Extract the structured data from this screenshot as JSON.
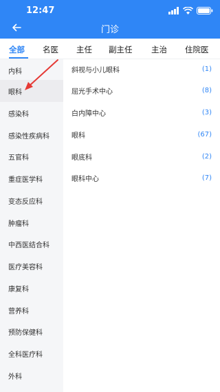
{
  "status": {
    "time": "12:47"
  },
  "header": {
    "title": "门诊"
  },
  "tabs": [
    "全部",
    "名医",
    "主任",
    "副主任",
    "主治",
    "住院医"
  ],
  "left_menu": [
    {
      "label": "内科"
    },
    {
      "label": "眼科"
    },
    {
      "label": "感染科"
    },
    {
      "label": "感染性疾病科"
    },
    {
      "label": "五官科"
    },
    {
      "label": "重症医学科"
    },
    {
      "label": "变态反应科"
    },
    {
      "label": "肿瘤科"
    },
    {
      "label": "中西医结合科"
    },
    {
      "label": "医疗美容科"
    },
    {
      "label": "康复科"
    },
    {
      "label": "营养科"
    },
    {
      "label": "预防保健科"
    },
    {
      "label": "全科医疗科"
    },
    {
      "label": "外科"
    }
  ],
  "right_list": [
    {
      "label": "斜视与小儿眼科",
      "count": "(1)"
    },
    {
      "label": "屈光手术中心",
      "count": "(8)"
    },
    {
      "label": "白内障中心",
      "count": "(3)"
    },
    {
      "label": "眼科",
      "count": "(67)"
    },
    {
      "label": "眼底科",
      "count": "(2)"
    },
    {
      "label": "眼科中心",
      "count": "(7)"
    }
  ],
  "colors": {
    "accent": "#2f86f6",
    "annotation": "#e53935"
  }
}
